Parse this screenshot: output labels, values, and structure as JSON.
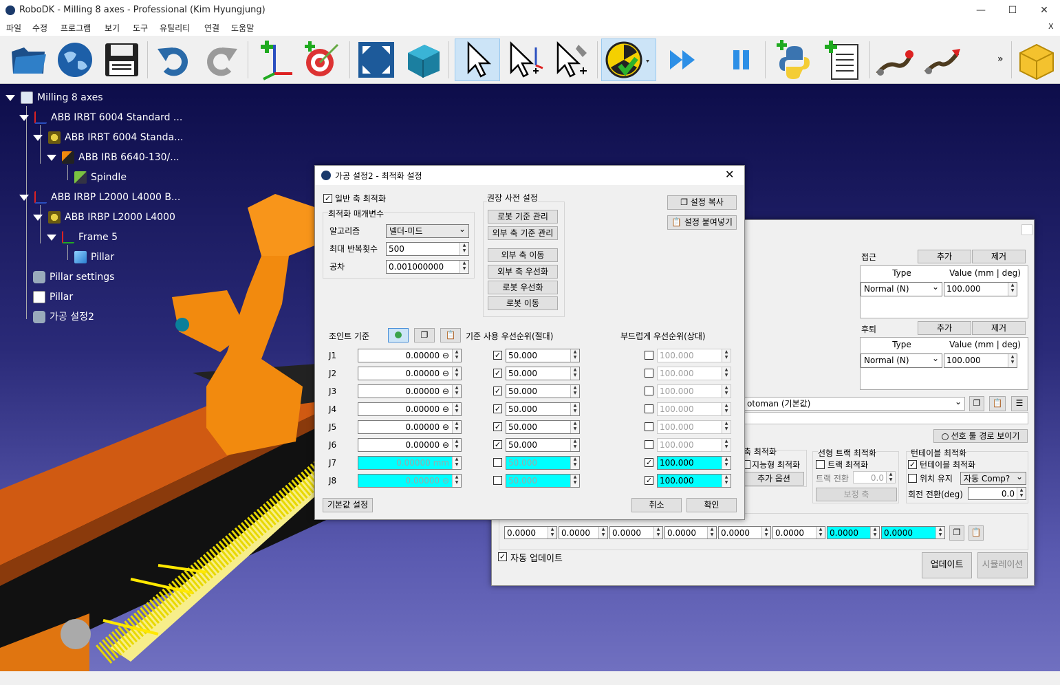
{
  "window": {
    "title": "RoboDK - Milling 8 axes - Professional (Kim Hyungjung)",
    "close_x": "X"
  },
  "menu": [
    "파일",
    "수정",
    "프로그램",
    "보기",
    "도구",
    "유틸리티",
    "연결",
    "도움말"
  ],
  "toolbar": {
    "icons": [
      "open-folder-icon",
      "globe-icon",
      "save-icon",
      "undo-icon",
      "redo-icon",
      "add-reference-frame-icon",
      "add-target-icon",
      "fit-all-icon",
      "3d-view-icon",
      "select-icon",
      "move-reference-icon",
      "move-tool-icon",
      "collision-check-icon",
      "run-program-icon",
      "pause-icon",
      "add-python-program-icon",
      "add-program-icon",
      "curve-follow-icon",
      "point-follow-icon",
      "package-icon"
    ],
    "more": "»"
  },
  "tree": [
    {
      "label": "Milling 8 axes",
      "icon": "station-icon"
    },
    {
      "label": "ABB IRBT 6004 Standard ...",
      "icon": "frame-icon"
    },
    {
      "label": "ABB IRBT 6004 Standa...",
      "icon": "mechanism-icon"
    },
    {
      "label": "ABB IRB 6640-130/...",
      "icon": "robot-icon"
    },
    {
      "label": "Spindle",
      "icon": "tool-icon"
    },
    {
      "label": "ABB IRBP L2000 L4000 B...",
      "icon": "frame-icon"
    },
    {
      "label": "ABB IRBP L2000 L4000",
      "icon": "mechanism-icon"
    },
    {
      "label": "Frame 5",
      "icon": "frame-icon"
    },
    {
      "label": "Pillar",
      "icon": "object-icon"
    },
    {
      "label": "Pillar settings",
      "icon": "milling-settings-icon"
    },
    {
      "label": "Pillar",
      "icon": "program-icon"
    },
    {
      "label": "가공 설정2",
      "icon": "milling-settings-icon"
    }
  ],
  "bg_dialog": {
    "approach": {
      "label": "접근",
      "add": "추가",
      "remove": "제거",
      "col_type": "Type",
      "col_value": "Value (mm | deg)",
      "type": "Normal (N)",
      "value": "100.000"
    },
    "retract": {
      "label": "후퇴",
      "add": "추가",
      "remove": "제거",
      "col_type": "Type",
      "col_value": "Value (mm | deg)",
      "type": "Normal (N)",
      "value": "100.000"
    },
    "robot_combo": "otoman (기본값)",
    "preferred_path": "선호 툴 경로 보이기",
    "axis_opt": {
      "title": "축 최적화",
      "smart": "지능형 최적화",
      "more": "추가 옵션"
    },
    "linear_track": {
      "title": "선형 트랙 최적화",
      "track_opt": "트랙 최적화",
      "track_change": "트랙 전환",
      "track_value": "0.0",
      "correct": "보정 축"
    },
    "turntable": {
      "title": "턴테이블 최적화",
      "tt_opt": "턴테이블 최적화",
      "pos_keep": "위치 유지",
      "auto_comp": "자동 Comp?",
      "rot_change": "회전 전환(deg)",
      "rot_value": "0.0"
    },
    "joints": [
      "0.0000",
      "0.0000",
      "0.0000",
      "0.0000",
      "0.0000",
      "0.0000",
      "0.0000",
      "0.0000"
    ],
    "auto_update": "자동 업데이트",
    "update": "업데이트",
    "simulate": "시뮬레이션"
  },
  "dialog": {
    "title": "가공 설정2 - 최적화 설정",
    "general_axis_opt": "일반 축 최적화",
    "opt_params": "최적화 매개변수",
    "algorithm_label": "알고리즘",
    "algorithm": "넬더-미드",
    "max_iter_label": "최대 반복횟수",
    "max_iter": "500",
    "tolerance_label": "공차",
    "tolerance": "0.001000000",
    "recommended": "권장 사전 설정",
    "presets": [
      "로봇 기준 관리",
      "외부 축 기준 관리",
      "외부 축 이동",
      "외부 축 우선화",
      "로봇 우선화",
      "로봇 이동"
    ],
    "copy_settings": "설정 복사",
    "paste_settings": "설정 붙여넣기",
    "joint_ref": "조인트 기준",
    "ref_priority": "기준 사용 우선순위(절대)",
    "smooth_priority": "부드럽게 우선순위(상대)",
    "joints": [
      {
        "name": "J1",
        "ref": "0.00000 ⊖",
        "use": true,
        "prio": "50.000",
        "smooth": false,
        "sprio": "100.000"
      },
      {
        "name": "J2",
        "ref": "0.00000 ⊖",
        "use": true,
        "prio": "50.000",
        "smooth": false,
        "sprio": "100.000"
      },
      {
        "name": "J3",
        "ref": "0.00000 ⊖",
        "use": true,
        "prio": "50.000",
        "smooth": false,
        "sprio": "100.000"
      },
      {
        "name": "J4",
        "ref": "0.00000 ⊖",
        "use": true,
        "prio": "50.000",
        "smooth": false,
        "sprio": "100.000"
      },
      {
        "name": "J5",
        "ref": "0.00000 ⊖",
        "use": true,
        "prio": "50.000",
        "smooth": false,
        "sprio": "100.000"
      },
      {
        "name": "J6",
        "ref": "0.00000 ⊖",
        "use": true,
        "prio": "50.000",
        "smooth": false,
        "sprio": "100.000"
      },
      {
        "name": "J7",
        "ref": "0.00000 mm",
        "use": false,
        "prio": "50.000",
        "smooth": true,
        "sprio": "100.000"
      },
      {
        "name": "J8",
        "ref": "0.00000 ⊖",
        "use": false,
        "prio": "50.000",
        "smooth": true,
        "sprio": "100.000"
      }
    ],
    "defaults": "기본값 설정",
    "cancel": "취소",
    "ok": "확인"
  }
}
